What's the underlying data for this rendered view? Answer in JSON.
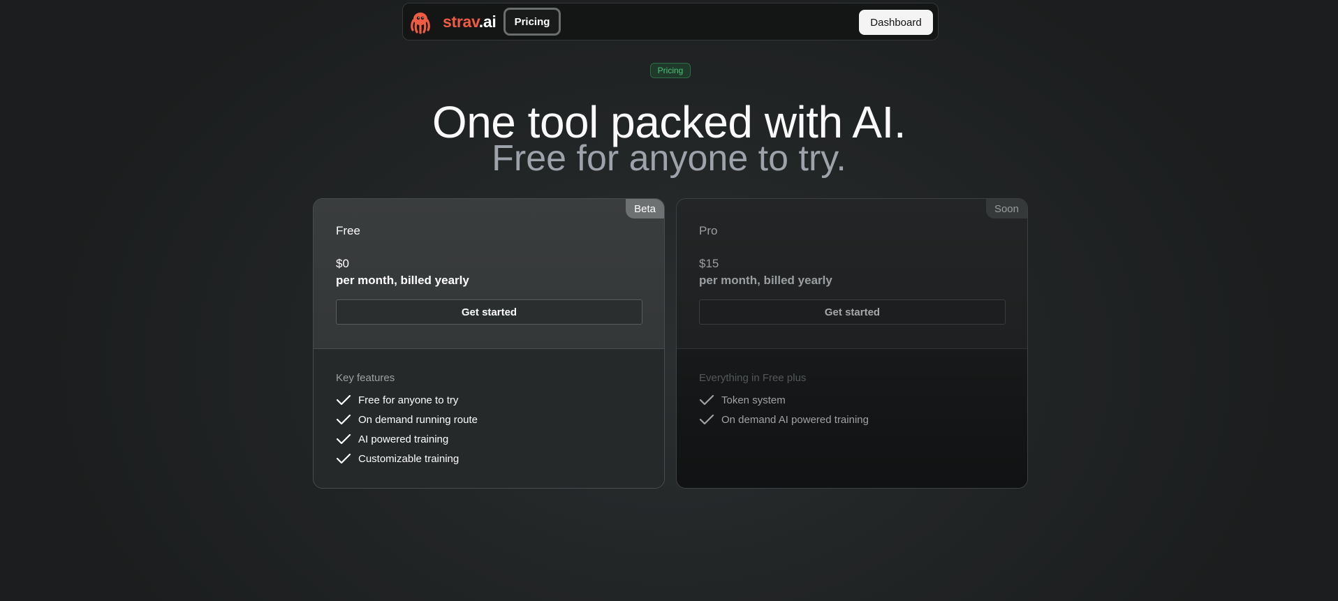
{
  "nav": {
    "brand_main": "strav",
    "brand_tld": ".ai",
    "pricing_label": "Pricing",
    "dashboard_label": "Dashboard"
  },
  "hero": {
    "badge": "Pricing",
    "title": "One tool packed with AI.",
    "subtitle": "Free for anyone to try."
  },
  "plans": [
    {
      "badge": "Beta",
      "name": "Free",
      "price": "$0",
      "period": "per month, billed yearly",
      "cta": "Get started",
      "features_title": "Key features",
      "features": [
        "Free for anyone to try",
        "On demand running route",
        "AI powered training",
        "Customizable training"
      ]
    },
    {
      "badge": "Soon",
      "name": "Pro",
      "price": "$15",
      "period": "per month, billed yearly",
      "cta": "Get started",
      "features_title": "Everything in Free plus",
      "features": [
        "Token system",
        "On demand AI powered training"
      ]
    }
  ],
  "colors": {
    "brand": "#ef5c44",
    "badge_green": "#4ec27a",
    "background": "#232627"
  },
  "icons": {
    "logo": "octopus-logo-icon",
    "check": "check-icon"
  }
}
